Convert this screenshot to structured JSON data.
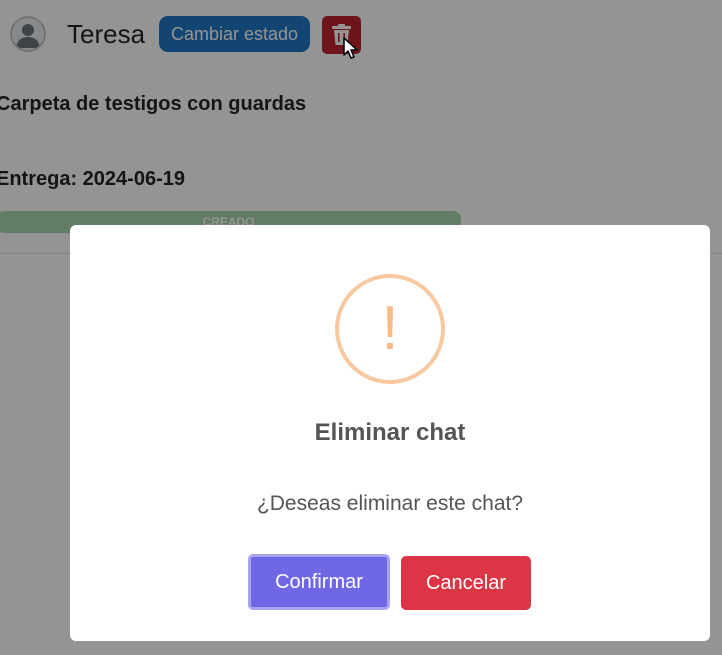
{
  "chat_header": {
    "user_name": "Teresa",
    "status_button_label": "Cambiar estado",
    "avatar_icon": "user-silhouette-icon",
    "delete_icon": "trash-icon"
  },
  "project": {
    "title": "Carpeta de testigos con guardas",
    "delivery": "Entrega: 2024-06-19",
    "state": "CREADO"
  },
  "dialog": {
    "icon": "warning-exclamation-icon",
    "icon_symbol": "!",
    "title": "Eliminar chat",
    "text": "¿Deseas eliminar este chat?",
    "confirm_label": "Confirmar",
    "cancel_label": "Cancelar"
  },
  "colors": {
    "status_button": "#2178c4",
    "delete_button": "#c0242f",
    "state_bar": "#a9d6b0",
    "warning": "#f8bb86",
    "confirm": "#7067e5",
    "cancel": "#dc3545"
  }
}
